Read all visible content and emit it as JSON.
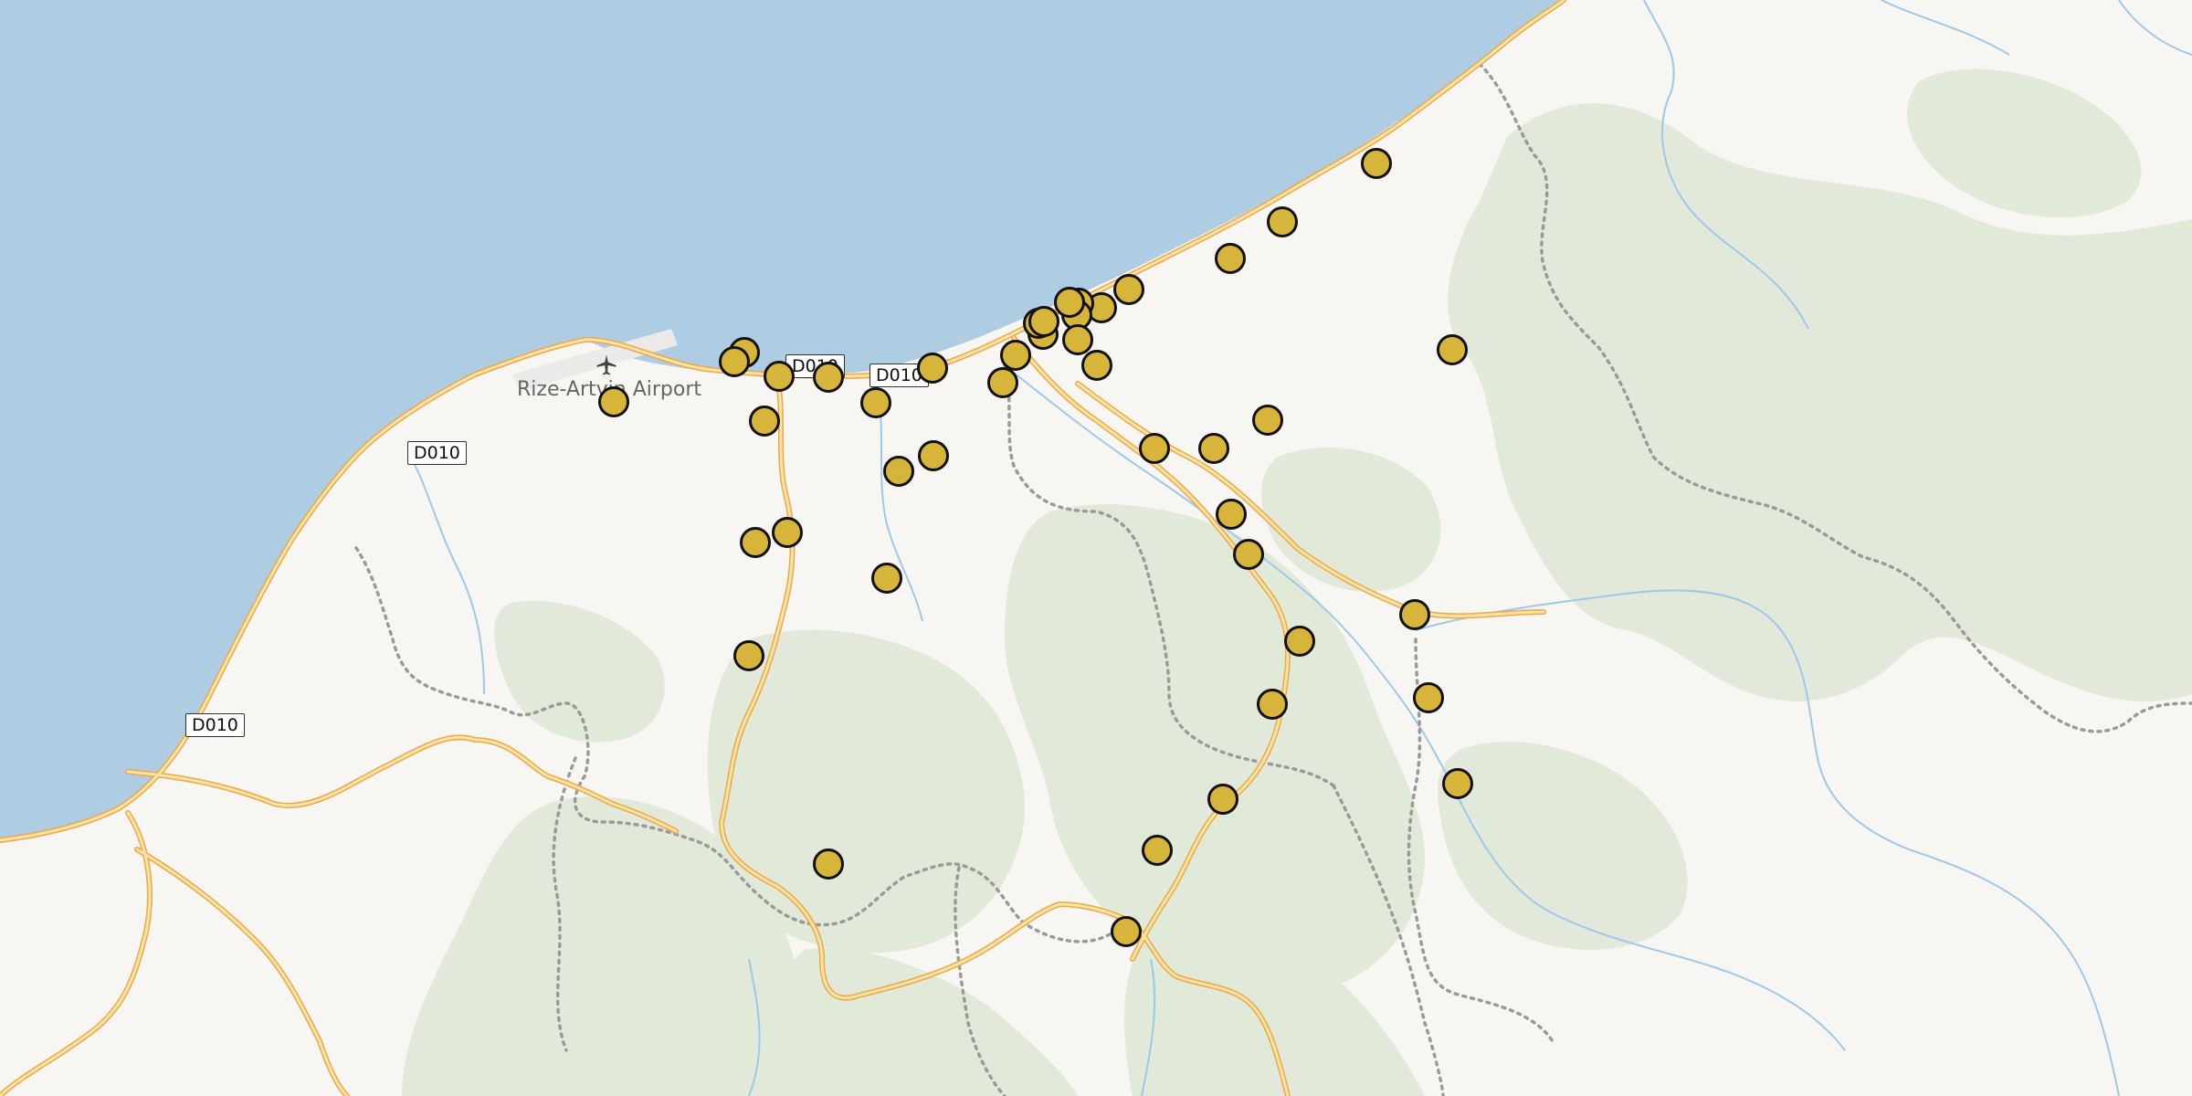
{
  "map": {
    "colors": {
      "sea": "#aecde2",
      "land": "#f8f6f2",
      "forest": "#dfe8d7",
      "road_casing": "#e9a94c",
      "road_fill": "#fde3a3",
      "river": "#9ec8ea",
      "boundary": "#9a9a9a",
      "marker_fill": "#d7b43a",
      "marker_stroke": "#111111"
    },
    "airport": {
      "label": "Rize-Artvin Airport",
      "icon": "airplane-icon"
    },
    "road_shields": [
      {
        "label": "D010"
      },
      {
        "label": "D010"
      },
      {
        "label": "D010"
      },
      {
        "label": "D010"
      }
    ],
    "marker_count": 44
  }
}
